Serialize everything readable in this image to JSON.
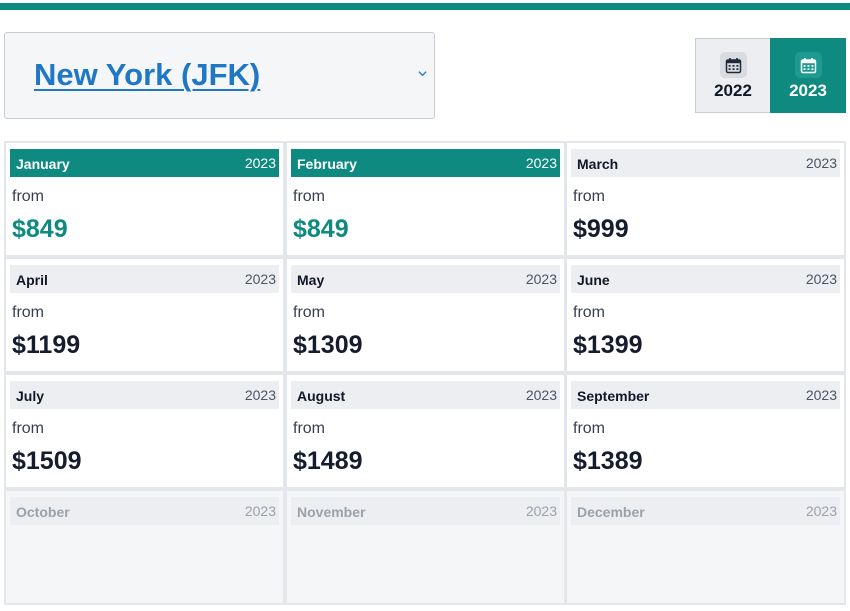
{
  "header": {
    "city": "New York (JFK)",
    "years": [
      {
        "label": "2022",
        "selected": false
      },
      {
        "label": "2023",
        "selected": true
      }
    ]
  },
  "colors": {
    "accent": "#0e8a80",
    "link": "#1f77c6",
    "price": "#141c2e"
  },
  "icons": {
    "chevron": "chevron-down-icon",
    "calendar": "calendar-icon"
  },
  "months": [
    {
      "month": "January",
      "year": "2023",
      "from": "from",
      "price": "$849",
      "state": "active"
    },
    {
      "month": "February",
      "year": "2023",
      "from": "from",
      "price": "$849",
      "state": "active"
    },
    {
      "month": "March",
      "year": "2023",
      "from": "from",
      "price": "$999",
      "state": "normal"
    },
    {
      "month": "April",
      "year": "2023",
      "from": "from",
      "price": "$1199",
      "state": "normal"
    },
    {
      "month": "May",
      "year": "2023",
      "from": "from",
      "price": "$1309",
      "state": "normal"
    },
    {
      "month": "June",
      "year": "2023",
      "from": "from",
      "price": "$1399",
      "state": "normal"
    },
    {
      "month": "July",
      "year": "2023",
      "from": "from",
      "price": "$1509",
      "state": "normal"
    },
    {
      "month": "August",
      "year": "2023",
      "from": "from",
      "price": "$1489",
      "state": "normal"
    },
    {
      "month": "September",
      "year": "2023",
      "from": "from",
      "price": "$1389",
      "state": "normal"
    },
    {
      "month": "October",
      "year": "2023",
      "state": "disabled"
    },
    {
      "month": "November",
      "year": "2023",
      "state": "disabled"
    },
    {
      "month": "December",
      "year": "2023",
      "state": "disabled"
    }
  ]
}
